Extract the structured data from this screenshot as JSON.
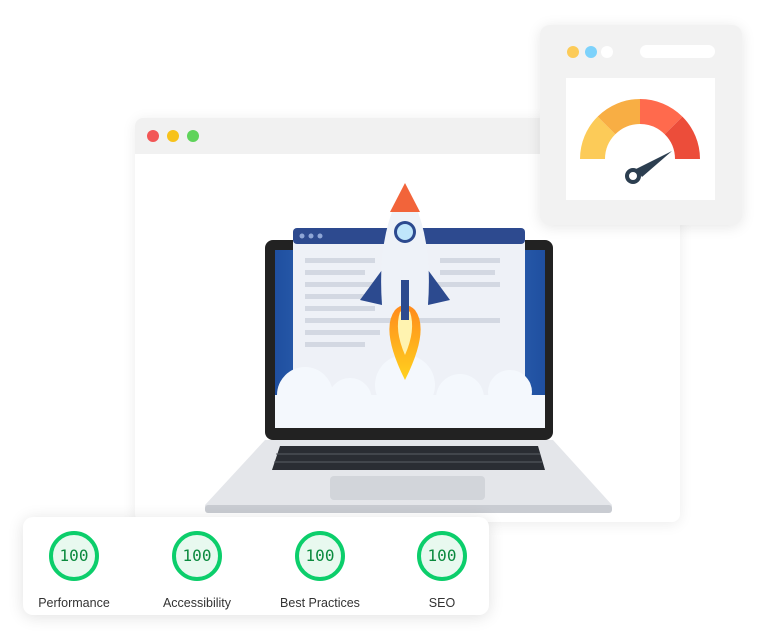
{
  "scores": [
    {
      "label": "Performance",
      "value": "100"
    },
    {
      "label": "Accessibility",
      "value": "100"
    },
    {
      "label": "Best Practices",
      "value": "100"
    },
    {
      "label": "SEO",
      "value": "100"
    }
  ],
  "colors": {
    "score_ring": "#0cce6b",
    "score_text": "#0b8a3e",
    "dot_red": "#f25656",
    "dot_yellow": "#f7c21b",
    "dot_green": "#5fd35a",
    "gauge_yellow": "#fccb58",
    "gauge_orange": "#f8ae44",
    "gauge_red": "#ff6a4d",
    "gauge_darkred": "#ec4d3a",
    "needle": "#2c3e50"
  },
  "icons": [
    "rocket-illustration",
    "laptop-illustration",
    "speedometer-gauge-icon"
  ]
}
